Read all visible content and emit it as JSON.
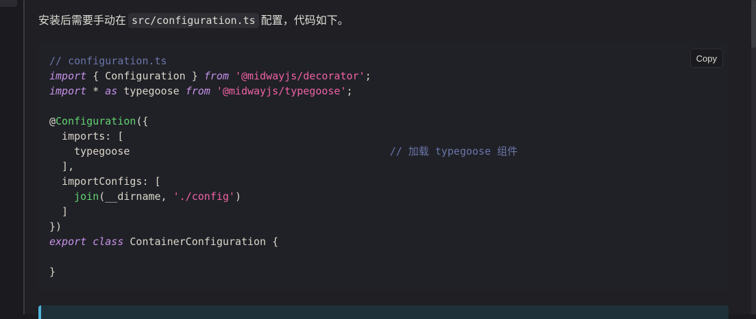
{
  "intro": {
    "before": "安装后需要手动在",
    "code": "src/configuration.ts",
    "after": "配置，代码如下。"
  },
  "code_block": {
    "copy_label": "Copy",
    "lines": [
      [
        {
          "t": "comment",
          "v": "// configuration.ts"
        }
      ],
      [
        {
          "t": "keyword",
          "v": "import"
        },
        {
          "t": "plain",
          "v": " { Configuration } "
        },
        {
          "t": "keyword",
          "v": "from"
        },
        {
          "t": "plain",
          "v": " "
        },
        {
          "t": "string",
          "v": "'@midwayjs/decorator'"
        },
        {
          "t": "plain",
          "v": ";"
        }
      ],
      [
        {
          "t": "keyword",
          "v": "import"
        },
        {
          "t": "plain",
          "v": " * "
        },
        {
          "t": "keyword",
          "v": "as"
        },
        {
          "t": "plain",
          "v": " typegoose "
        },
        {
          "t": "keyword",
          "v": "from"
        },
        {
          "t": "plain",
          "v": " "
        },
        {
          "t": "string",
          "v": "'@midwayjs/typegoose'"
        },
        {
          "t": "plain",
          "v": ";"
        }
      ],
      [],
      [
        {
          "t": "plain",
          "v": "@"
        },
        {
          "t": "func",
          "v": "Configuration"
        },
        {
          "t": "plain",
          "v": "({"
        }
      ],
      [
        {
          "t": "plain",
          "v": "  imports: ["
        }
      ],
      [
        {
          "t": "plain",
          "v": "    typegoose                                          "
        },
        {
          "t": "comment",
          "v": "// 加载 typegoose 组件"
        }
      ],
      [
        {
          "t": "plain",
          "v": "  ],"
        }
      ],
      [
        {
          "t": "plain",
          "v": "  importConfigs: ["
        }
      ],
      [
        {
          "t": "plain",
          "v": "    "
        },
        {
          "t": "func",
          "v": "join"
        },
        {
          "t": "plain",
          "v": "(__dirname, "
        },
        {
          "t": "string",
          "v": "'./config'"
        },
        {
          "t": "plain",
          "v": ")"
        }
      ],
      [
        {
          "t": "plain",
          "v": "  ]"
        }
      ],
      [
        {
          "t": "plain",
          "v": "})"
        }
      ],
      [
        {
          "t": "keyword",
          "v": "export"
        },
        {
          "t": "plain",
          "v": " "
        },
        {
          "t": "keyword",
          "v": "class"
        },
        {
          "t": "plain",
          "v": " ContainerConfiguration {"
        }
      ],
      [],
      [
        {
          "t": "plain",
          "v": "}"
        }
      ]
    ]
  },
  "colors": {
    "comment": "#6a76a8",
    "keyword": "#c792ea",
    "string": "#f062a5",
    "function": "#63d471",
    "tip_accent": "#4fb3d9"
  }
}
